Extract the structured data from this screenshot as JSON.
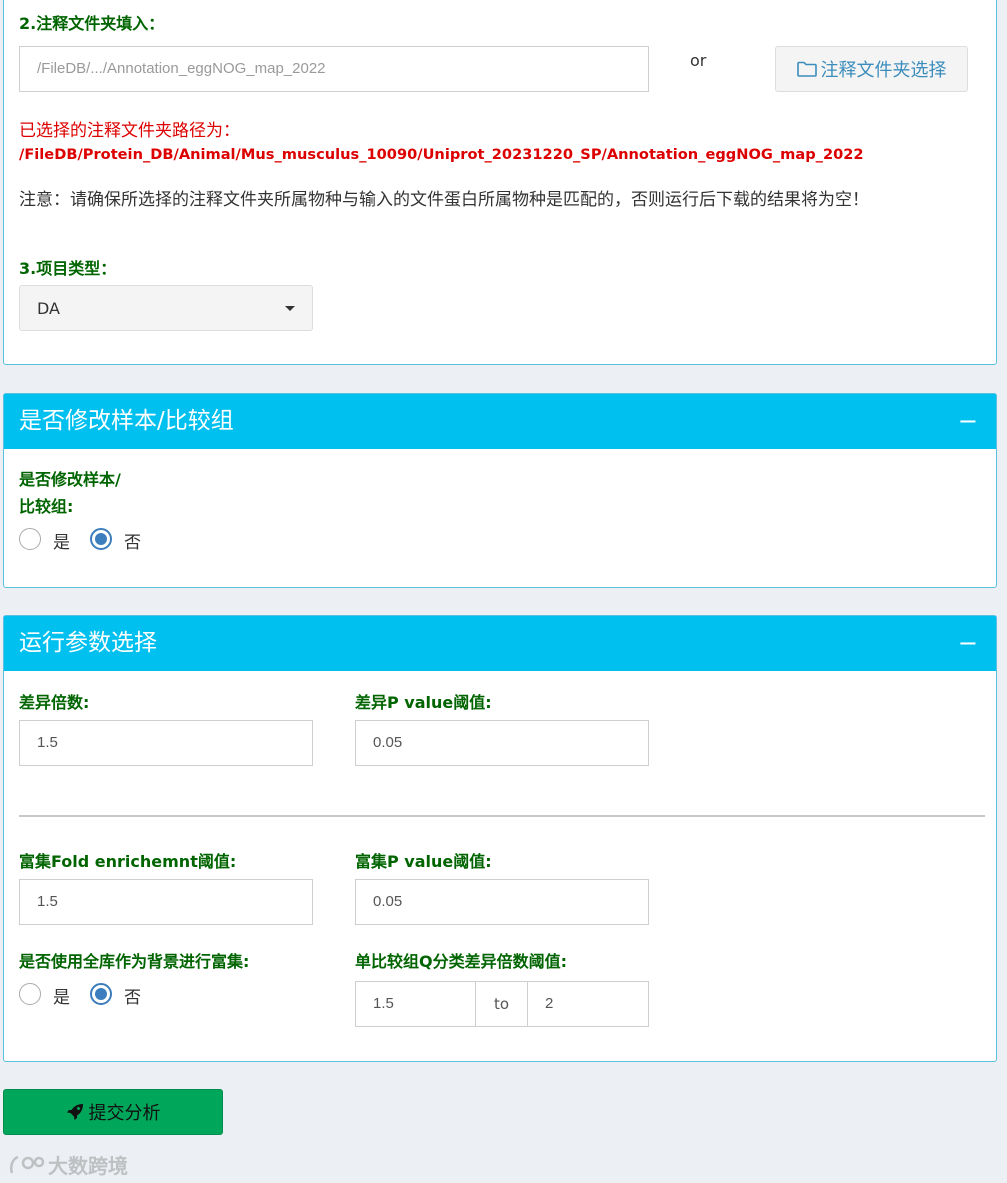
{
  "annotation": {
    "section_label": "2.注释文件夹填入：",
    "path_input_placeholder": "/FileDB/.../Annotation_eggNOG_map_2022",
    "or_text": "or",
    "choose_button_label": "注释文件夹选择",
    "selected_caption": "已选择的注释文件夹路径为：",
    "selected_path": "/FileDB/Protein_DB/Animal/Mus_musculus_10090/Uniprot_20231220_SP/Annotation_eggNOG_map_2022",
    "notice": "注意：请确保所选择的注释文件夹所属物种与输入的文件蛋白所属物种是匹配的，否则运行后下载的结果将为空！"
  },
  "project": {
    "section_label": "3.项目类型：",
    "selected_type": "DA"
  },
  "modify_box": {
    "title": "是否修改样本/比较组",
    "collapse_symbol": "−",
    "question_line1": "是否修改样本/",
    "question_line2": "比较组:",
    "option_yes": "是",
    "option_no": "否",
    "selected": "否"
  },
  "params_box": {
    "title": "运行参数选择",
    "collapse_symbol": "−",
    "diff_fold_label": "差异倍数:",
    "diff_fold_value": "1.5",
    "diff_p_label": "差异P value阈值:",
    "diff_p_value": "0.05",
    "enrich_fold_label": "富集Fold enrichemnt阈值:",
    "enrich_fold_value": "1.5",
    "enrich_p_label": "富集P value阈值:",
    "enrich_p_value": "0.05",
    "background_label": "是否使用全库作为背景进行富集:",
    "option_yes": "是",
    "option_no": "否",
    "background_selected": "否",
    "q_class_label": "单比较组Q分类差异倍数阈值:",
    "q_from_value": "1.5",
    "q_to_text": "to",
    "q_to_value": "2"
  },
  "submit": {
    "label": "提交分析",
    "color": "#00a65a"
  },
  "watermark": {
    "text": "大数跨境"
  }
}
